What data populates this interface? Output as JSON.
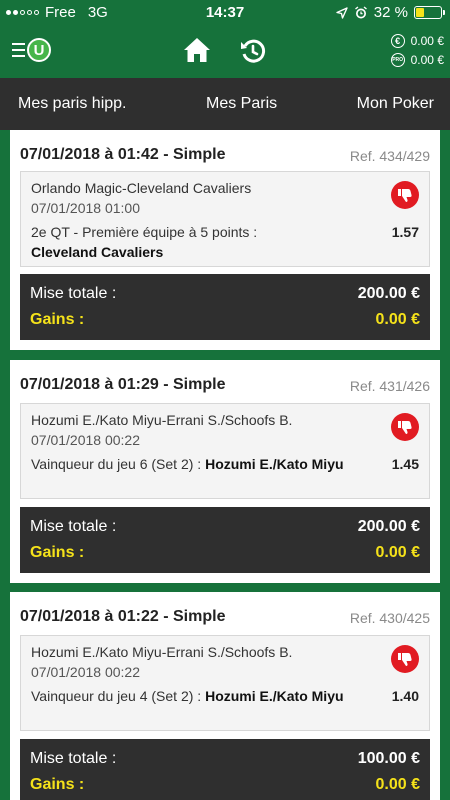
{
  "status_bar": {
    "carrier": "Free",
    "network": "3G",
    "time": "14:37",
    "battery": "32 %",
    "battery_level": 0.32
  },
  "header": {
    "menu_logo_letter": "U",
    "balances": [
      {
        "icon": "€",
        "value": "0.00 €"
      },
      {
        "icon": "PRO",
        "value": "0.00 €"
      }
    ]
  },
  "tabs": [
    "Mes paris hipp.",
    "Mes Paris",
    "Mon Poker"
  ],
  "bets": [
    {
      "title": "07/01/2018 à 01:42 - Simple",
      "ref": "Ref. 434/429",
      "event": "Orlando Magic-Cleveland Cavaliers",
      "event_date": "07/01/2018 01:00",
      "market": "2e QT - Première équipe à 5 points :",
      "selection": "Cleveland Cavaliers",
      "odds": "1.57",
      "mise_label": "Mise totale :",
      "mise_value": "200.00 €",
      "gains_label": "Gains :",
      "gains_value": "0.00 €"
    },
    {
      "title": "07/01/2018 à 01:29 - Simple",
      "ref": "Ref. 431/426",
      "event": "Hozumi E./Kato Miyu-Errani S./Schoofs B.",
      "event_date": "07/01/2018 00:22",
      "market": "Vainqueur du jeu 6 (Set 2) :",
      "selection": "Hozumi E./Kato Miyu",
      "odds": "1.45",
      "mise_label": "Mise totale :",
      "mise_value": "200.00 €",
      "gains_label": "Gains :",
      "gains_value": "0.00 €"
    },
    {
      "title": "07/01/2018 à 01:22 - Simple",
      "ref": "Ref. 430/425",
      "event": "Hozumi E./Kato Miyu-Errani S./Schoofs B.",
      "event_date": "07/01/2018 00:22",
      "market": "Vainqueur du jeu 4 (Set 2) :",
      "selection": "Hozumi E./Kato Miyu",
      "odds": "1.40",
      "mise_label": "Mise totale :",
      "mise_value": "100.00 €",
      "gains_label": "Gains :",
      "gains_value": "0.00 €"
    }
  ],
  "colors": {
    "brand_green": "#16723b",
    "dark_bar": "#2f2f2f",
    "gains_yellow": "#f5e21a",
    "lost_red": "#e11b22"
  }
}
